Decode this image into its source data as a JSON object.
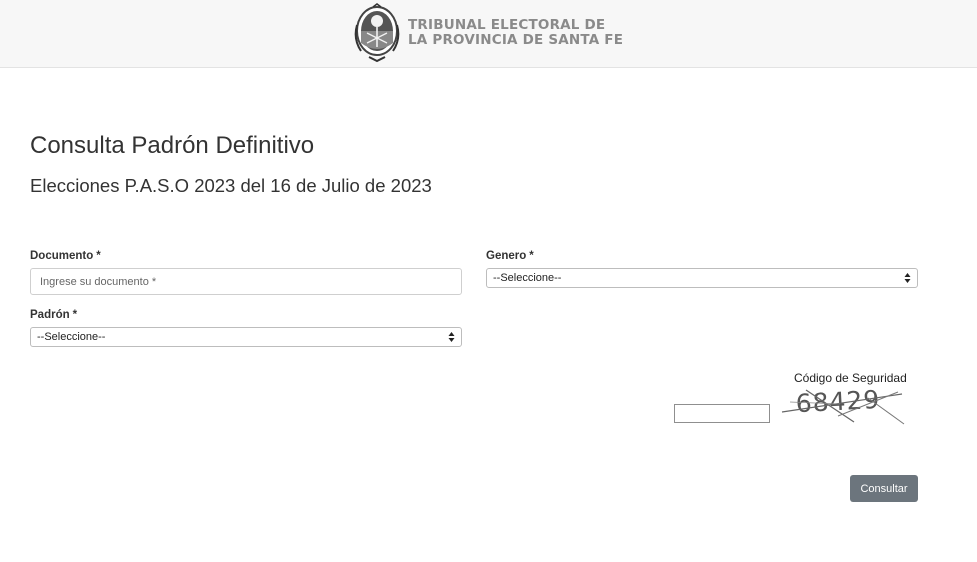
{
  "header": {
    "logo_line1": "TRIBUNAL ELECTORAL DE",
    "logo_line2": "LA PROVINCIA DE SANTA FE",
    "seal_icon": "provincial-seal-icon"
  },
  "page": {
    "title": "Consulta Padrón Definitivo",
    "subtitle": "Elecciones P.A.S.O 2023 del 16 de Julio de 2023"
  },
  "form": {
    "documento": {
      "label": "Documento",
      "required_mark": "*",
      "placeholder": "Ingrese su documento *",
      "value": ""
    },
    "genero": {
      "label": "Genero",
      "required_mark": "*",
      "selected": "--Seleccione--"
    },
    "padron": {
      "label": "Padrón",
      "required_mark": "*",
      "selected": "--Seleccione--"
    },
    "captcha": {
      "label": "Código de Seguridad",
      "image_text": "68429",
      "value": ""
    },
    "submit_label": "Consultar"
  },
  "colors": {
    "button_bg": "#6c757d",
    "header_bg": "#f7f7f7",
    "logo_text": "#8a8a8a"
  }
}
